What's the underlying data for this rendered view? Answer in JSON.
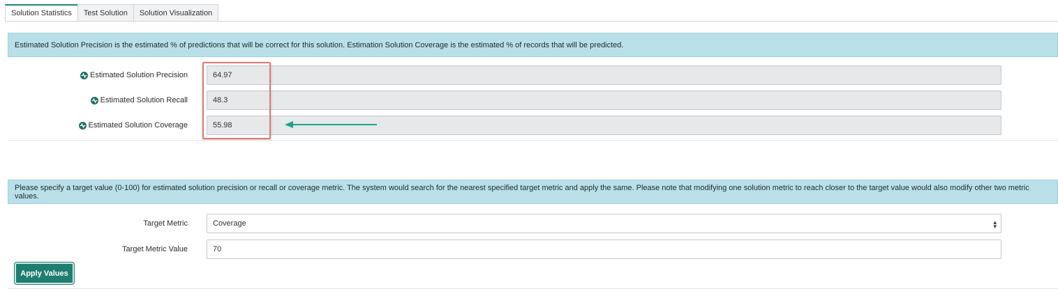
{
  "tabs": [
    {
      "label": "Solution Statistics",
      "active": true
    },
    {
      "label": "Test Solution",
      "active": false
    },
    {
      "label": "Solution Visualization",
      "active": false
    }
  ],
  "stats_info": "Estimated Solution Precision is the estimated % of predictions that will be correct for this solution. Estimation Solution Coverage is the estimated % of records that will be predicted.",
  "stats": {
    "precision": {
      "label": "Estimated Solution Precision",
      "value": "64.97",
      "icon": "activity-icon"
    },
    "recall": {
      "label": "Estimated Solution Recall",
      "value": "48.3",
      "icon": "activity-icon"
    },
    "coverage": {
      "label": "Estimated Solution Coverage",
      "value": "55.98",
      "icon": "activity-icon"
    }
  },
  "target_info": "Please specify a target value (0-100) for estimated solution precision or recall or coverage metric. The system would search for the nearest specified target metric and apply the same. Please note that modifying one solution metric to reach closer to the target value would also modify other two metric values.",
  "target": {
    "metric_label": "Target Metric",
    "metric_value": "Coverage",
    "value_label": "Target Metric Value",
    "value": "70"
  },
  "apply_label": "Apply Values",
  "colors": {
    "accent": "#1f7e70",
    "info_bg": "#b9e0e8",
    "highlight": "#e07a72",
    "arrow": "#1aa38e"
  }
}
